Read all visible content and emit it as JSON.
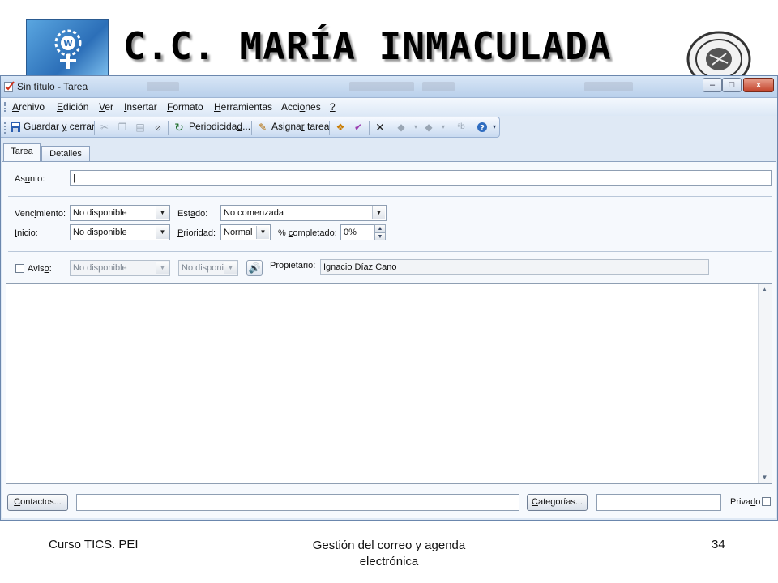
{
  "slide": {
    "title": "C.C. MARÍA INMACULADA",
    "footer_left": "Curso TICS. PEI",
    "footer_center_line1": "Gestión del correo y agenda",
    "footer_center_line2": "electrónica",
    "page_number": "34"
  },
  "window": {
    "title": "Sin título - Tarea",
    "controls": {
      "minimize": "–",
      "maximize": "□",
      "close": "x"
    }
  },
  "menu": {
    "archivo": {
      "u": "A",
      "rest": "rchivo"
    },
    "edicion": {
      "u": "E",
      "rest": "dición"
    },
    "ver": {
      "u": "V",
      "rest": "er"
    },
    "insertar": {
      "u": "I",
      "rest": "nsertar"
    },
    "formato": {
      "u": "F",
      "rest": "ormato"
    },
    "herramientas": {
      "u": "H",
      "rest": "erramientas"
    },
    "acciones": {
      "pre": "Acci",
      "u": "o",
      "rest": "nes"
    },
    "ayuda": {
      "u": "?"
    }
  },
  "toolbar": {
    "guardar": {
      "pre": "Guardar ",
      "u": "y",
      "rest": " cerrar"
    },
    "periodicidad": {
      "pre": "Periodicida",
      "u": "d",
      "rest": "..."
    },
    "asignar": {
      "pre": "Asigna",
      "u": "r",
      "rest": " tarea"
    }
  },
  "tabs": {
    "tarea": "Tarea",
    "detalles": "Detalles"
  },
  "form": {
    "asunto": {
      "pre": "As",
      "u": "u",
      "rest": "nto:",
      "value": "|"
    },
    "vencimiento": {
      "pre": "Venc",
      "u": "i",
      "rest": "miento:",
      "value": "No disponible"
    },
    "inicio": {
      "u": "I",
      "rest": "nicio:",
      "value": "No disponible"
    },
    "estado": {
      "pre": "Est",
      "u": "a",
      "rest": "do:",
      "value": "No comenzada"
    },
    "prioridad": {
      "u": "P",
      "rest": "rioridad:",
      "value": "Normal"
    },
    "completado": {
      "pre": "% ",
      "u": "c",
      "rest": "ompletado:",
      "value": "0%"
    },
    "aviso": {
      "pre": "Avis",
      "u": "o",
      "rest": ":",
      "date": "No disponible",
      "time": "No disponib"
    },
    "propietario": {
      "label": "Propietario:",
      "value": "Ignacio Díaz Cano"
    }
  },
  "bottom": {
    "contactos": {
      "u": "C",
      "rest": "ontactos..."
    },
    "categorias": {
      "u": "C",
      "rest": "ategorías..."
    },
    "privado": {
      "pre": "Priva",
      "u": "d",
      "rest": "o"
    }
  },
  "icons": [
    "logo-icon",
    "seal-icon",
    "task-app-icon",
    "save-icon",
    "cut-icon",
    "copy-icon",
    "paste-icon",
    "attach-icon",
    "recurrence-icon",
    "assign-task-icon",
    "categorize-icon",
    "mark-complete-icon",
    "delete-icon",
    "up-icon",
    "down-icon",
    "format-icon",
    "help-icon",
    "sound-icon"
  ],
  "colors": {
    "titlebar": "#c9dcf1",
    "menubar": "#e4edf8",
    "close_button": "#c3432a",
    "panel": "#f6f9fd"
  }
}
